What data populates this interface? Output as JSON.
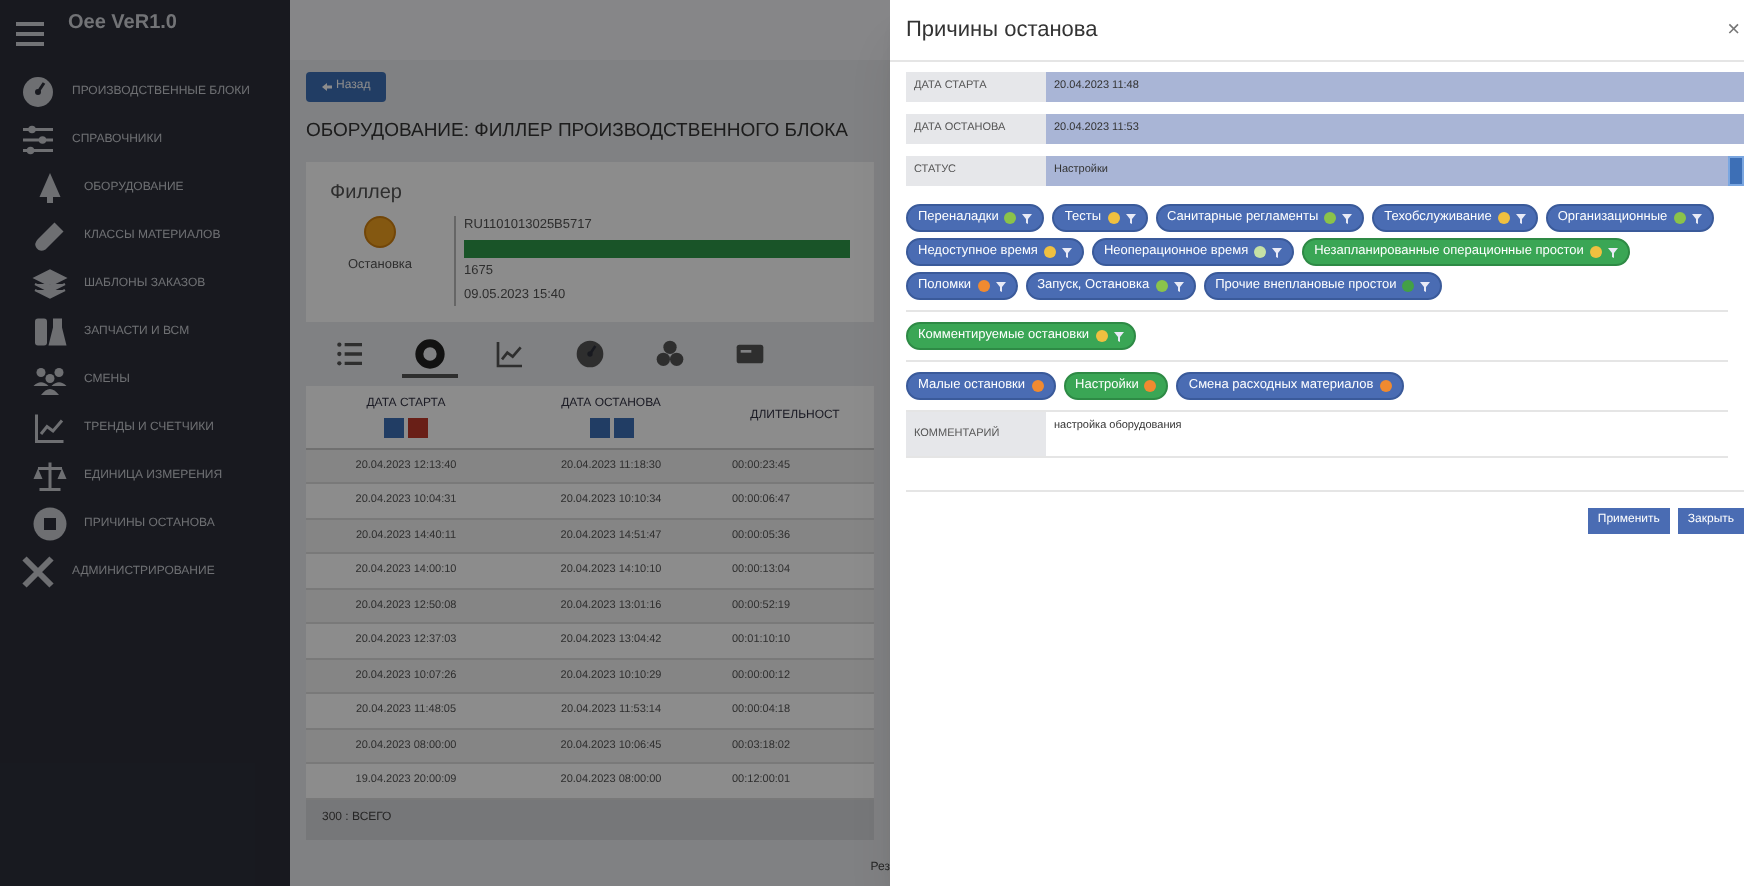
{
  "app": {
    "title": "Oee VeR1.0"
  },
  "sidebar": {
    "items": [
      {
        "label": "ПРОИЗВОДСТВЕННЫЕ БЛОКИ",
        "sub": false
      },
      {
        "label": "СПРАВОЧНИКИ",
        "sub": false
      },
      {
        "label": "ОБОРУДОВАНИЕ",
        "sub": true
      },
      {
        "label": "КЛАССЫ МАТЕРИАЛОВ",
        "sub": true
      },
      {
        "label": "ШАБЛОНЫ ЗАКАЗОВ",
        "sub": true
      },
      {
        "label": "ЗАПЧАСТИ И ВСМ",
        "sub": true
      },
      {
        "label": "СМЕНЫ",
        "sub": true
      },
      {
        "label": "ТРЕНДЫ И СЧЕТЧИКИ",
        "sub": true
      },
      {
        "label": "ЕДИНИЦА ИЗМЕРЕНИЯ",
        "sub": true
      },
      {
        "label": "ПРИЧИНЫ ОСТАНОВА",
        "sub": true
      },
      {
        "label": "АДМИНИСТРИРОВАНИЕ",
        "sub": false
      }
    ]
  },
  "main": {
    "back_button": "Назад",
    "title": "ОБОРУДОВАНИЕ: ФИЛЛЕР ПРОИЗВОДСТВЕННОГО БЛОКА",
    "machine": {
      "name": "Филлер",
      "state": "Остановка",
      "code": "RU1101013025B5717",
      "level": 1,
      "count": "1675",
      "time": "09.05.2023 15:40"
    },
    "tabs": [
      {
        "selected": false
      },
      {
        "selected": true
      },
      {
        "selected": false
      },
      {
        "selected": false
      },
      {
        "selected": false
      },
      {
        "selected": false
      }
    ],
    "table": {
      "columns": [
        "ДАТА СТАРТА",
        "ДАТА ОСТАНОВА",
        "ДЛИТЕЛЬНОСТ"
      ],
      "rows": [
        [
          "20.04.2023 12:13:40",
          "20.04.2023 11:18:30",
          "00:00:23:45"
        ],
        [
          "20.04.2023 10:04:31",
          "20.04.2023 10:10:34",
          "00:00:06:47"
        ],
        [
          "20.04.2023 14:40:11",
          "20.04.2023 14:51:47",
          "00:00:05:36"
        ],
        [
          "20.04.2023 14:00:10",
          "20.04.2023 14:10:10",
          "00:00:13:04"
        ],
        [
          "20.04.2023 12:50:08",
          "20.04.2023 13:01:16",
          "00:00:52:19"
        ],
        [
          "20.04.2023 12:37:03",
          "20.04.2023 13:04:42",
          "00:01:10:10"
        ],
        [
          "20.04.2023 10:07:26",
          "20.04.2023 10:10:29",
          "00:00:00:12"
        ],
        [
          "20.04.2023 11:48:05",
          "20.04.2023 11:53:14",
          "00:00:04:18"
        ],
        [
          "20.04.2023 08:00:00",
          "20.04.2023 10:06:45",
          "00:03:18:02"
        ],
        [
          "19.04.2023 20:00:09",
          "20.04.2023 08:00:00",
          "00:12:00:01"
        ]
      ],
      "footer": "300 : ВСЕГО"
    },
    "bottom_text": "Рез"
  },
  "modal": {
    "title": "Причины останова",
    "close": "×",
    "fields": [
      {
        "label": "ДАТА СТАРТА",
        "value": "20.04.2023 11:48",
        "editable": false
      },
      {
        "label": "ДАТА ОСТАНОВА",
        "value": "20.04.2023 11:53",
        "editable": false
      },
      {
        "label": "СТАТУС",
        "value": "Настройки",
        "editable": true
      }
    ],
    "chip_groups": [
      [
        {
          "label": "Переналадки",
          "color": "#8bc34a",
          "selected": false,
          "filter_icon": true
        },
        {
          "label": "Тесты",
          "color": "#f0c040",
          "selected": false,
          "filter_icon": true
        },
        {
          "label": "Санитарные регламенты",
          "color": "#8bc34a",
          "selected": false,
          "filter_icon": true
        },
        {
          "label": "Техобслуживание",
          "color": "#f0c040",
          "selected": false,
          "filter_icon": true
        },
        {
          "label": "Организационные",
          "color": "#8bc34a",
          "selected": false,
          "filter_icon": true
        },
        {
          "label": "Недоступное время",
          "color": "#f0c040",
          "selected": false,
          "filter_icon": true
        },
        {
          "label": "Неоперационное время",
          "color": "#c5e1a5",
          "selected": false,
          "filter_icon": true
        },
        {
          "label": "Незапланированные операционные простои",
          "color": "#f0c040",
          "selected": true,
          "filter_icon": true
        },
        {
          "label": "Поломки",
          "color": "#f08a30",
          "selected": false,
          "filter_icon": true
        },
        {
          "label": "Запуск, Остановка",
          "color": "#8bc34a",
          "selected": false,
          "filter_icon": true
        },
        {
          "label": "Прочие внеплановые простои",
          "color": "#43a047",
          "selected": false,
          "filter_icon": true
        }
      ],
      [
        {
          "label": "Комментируемые остановки",
          "color": "#f0c040",
          "selected": true,
          "filter_icon": true
        }
      ],
      [
        {
          "label": "Малые остановки",
          "color": "#f08a30",
          "selected": false,
          "filter_icon": false
        },
        {
          "label": "Настройки",
          "color": "#f08a30",
          "selected": true,
          "filter_icon": false
        },
        {
          "label": "Смена расходных материалов",
          "color": "#f08a30",
          "selected": false,
          "filter_icon": false
        }
      ]
    ],
    "comment": {
      "label": "КОММЕНТАРИЙ",
      "value": "настройка оборудования"
    },
    "buttons": [
      "Применить",
      "Закрыть"
    ]
  }
}
